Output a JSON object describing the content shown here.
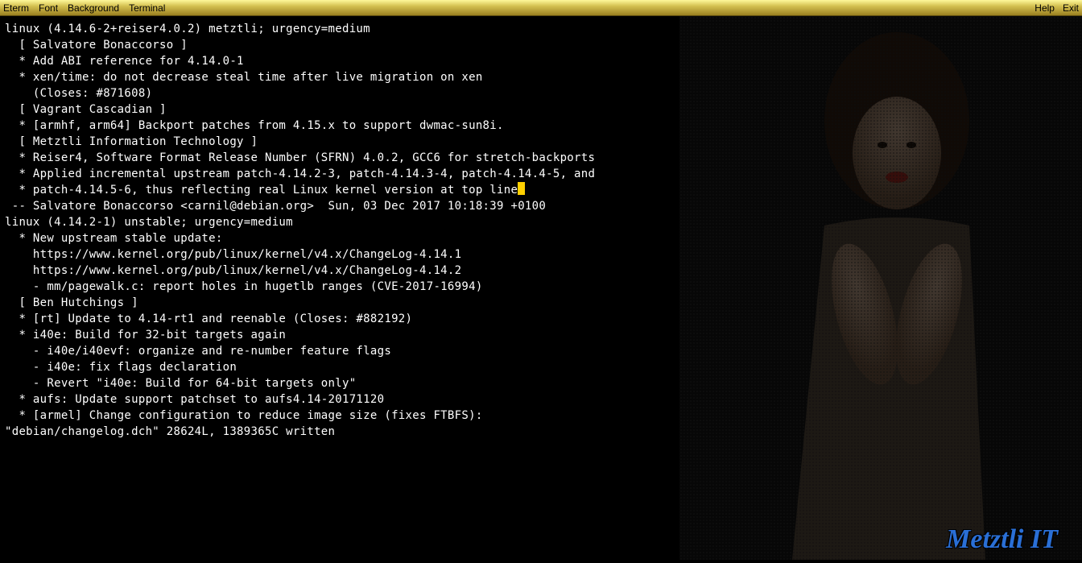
{
  "menubar": {
    "left": [
      "Eterm",
      "Font",
      "Background",
      "Terminal"
    ],
    "right": [
      "Help",
      "Exit"
    ]
  },
  "terminal_lines": [
    "linux (4.14.6-2+reiser4.0.2) metztli; urgency=medium",
    "",
    "  [ Salvatore Bonaccorso ]",
    "  * Add ABI reference for 4.14.0-1",
    "  * xen/time: do not decrease steal time after live migration on xen",
    "    (Closes: #871608)",
    "",
    "  [ Vagrant Cascadian ]",
    "  * [armhf, arm64] Backport patches from 4.15.x to support dwmac-sun8i.",
    "",
    "  [ Metztli Information Technology ]",
    "  * Reiser4, Software Format Release Number (SFRN) 4.0.2, GCC6 for stretch-backports",
    "  * Applied incremental upstream patch-4.14.2-3, patch-4.14.3-4, patch-4.14.4-5, and",
    "  * patch-4.14.5-6, thus reflecting real Linux kernel version at top line.",
    "",
    " -- Salvatore Bonaccorso <carnil@debian.org>  Sun, 03 Dec 2017 10:18:39 +0100",
    "",
    "linux (4.14.2-1) unstable; urgency=medium",
    "",
    "  * New upstream stable update:",
    "    https://www.kernel.org/pub/linux/kernel/v4.x/ChangeLog-4.14.1",
    "    https://www.kernel.org/pub/linux/kernel/v4.x/ChangeLog-4.14.2",
    "    - mm/pagewalk.c: report holes in hugetlb ranges (CVE-2017-16994)",
    "",
    "  [ Ben Hutchings ]",
    "  * [rt] Update to 4.14-rt1 and reenable (Closes: #882192)",
    "  * i40e: Build for 32-bit targets again",
    "    - i40e/i40evf: organize and re-number feature flags",
    "    - i40e: fix flags declaration",
    "    - Revert \"i40e: Build for 64-bit targets only\"",
    "  * aufs: Update support patchset to aufs4.14-20171120",
    "  * [armel] Change configuration to reduce image size (fixes FTBFS):",
    "\"debian/changelog.dch\" 28624L, 1389365C written"
  ],
  "cursor_line_index": 13,
  "watermark": "Metztli IT"
}
